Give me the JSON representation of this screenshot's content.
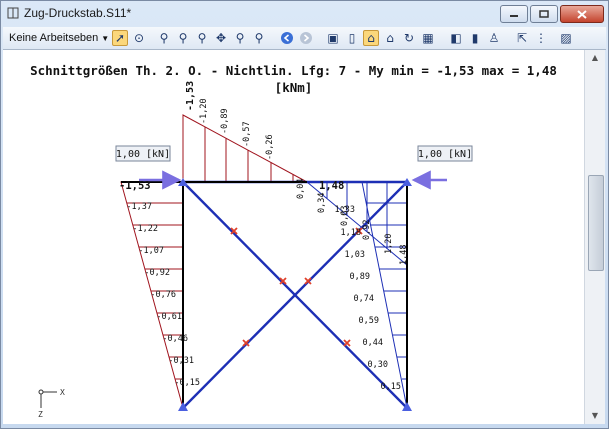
{
  "window": {
    "title": "Zug-Druckstab.S11*",
    "buttons": [
      "minimize",
      "maximize",
      "close"
    ]
  },
  "toolbar": {
    "workplane_label": "Keine Arbeitseben",
    "icons": [
      "select-arrow-icon",
      "lasso-select-icon",
      "zoom-window-icon",
      "zoom-in-icon",
      "zoom-out-icon",
      "pan-icon",
      "zoom-all-icon",
      "zoom-previous-icon",
      "back-icon",
      "forward-icon",
      "view-iso-icon",
      "view-front-icon",
      "view-home-icon",
      "view-camera-icon",
      "rotate-icon",
      "grid-icon",
      "render-icon",
      "render-solid-icon",
      "light-icon",
      "bulb-icon",
      "pointer-coord-icon",
      "numbering-icon",
      "picture-icon"
    ],
    "active_icon": "view-home-icon"
  },
  "chart": {
    "title_line1": "Schnittgrößen Th. 2. O. - Nichtlin. Lfg: 7 - My min = -1,53 max = 1,48",
    "title_line2": "[kNm]",
    "load_left": "1,00 [kN]",
    "load_right": "1,00 [kN]",
    "top_labels": [
      "-1,53",
      "-1,20",
      "-0,89",
      "-0,57",
      "-0,26",
      "0,04",
      "0,34",
      "0,63",
      "0,92",
      "1,20"
    ],
    "left_min": "-1,53",
    "right_max": "1,48",
    "right_rotated_max": "1,48",
    "left_labels": [
      "-1,37",
      "-1,22",
      "-1,07",
      "-0,92",
      "-0,76",
      "-0,61",
      "-0,46",
      "-0,31",
      "-0,15"
    ],
    "right_labels": [
      "1,18",
      "1,03",
      "0,89",
      "0,74",
      "0,59",
      "0,44",
      "0,30",
      "0,15"
    ],
    "right_top_extra": "1,33",
    "axis_x": "X",
    "axis_z": "Z"
  },
  "colors": {
    "member": "#1d2fb5",
    "diagram_left": "#a0141e",
    "diagram_right": "#1d2fb5",
    "hinge": "#e0402a",
    "support": "#4b5fe0"
  }
}
